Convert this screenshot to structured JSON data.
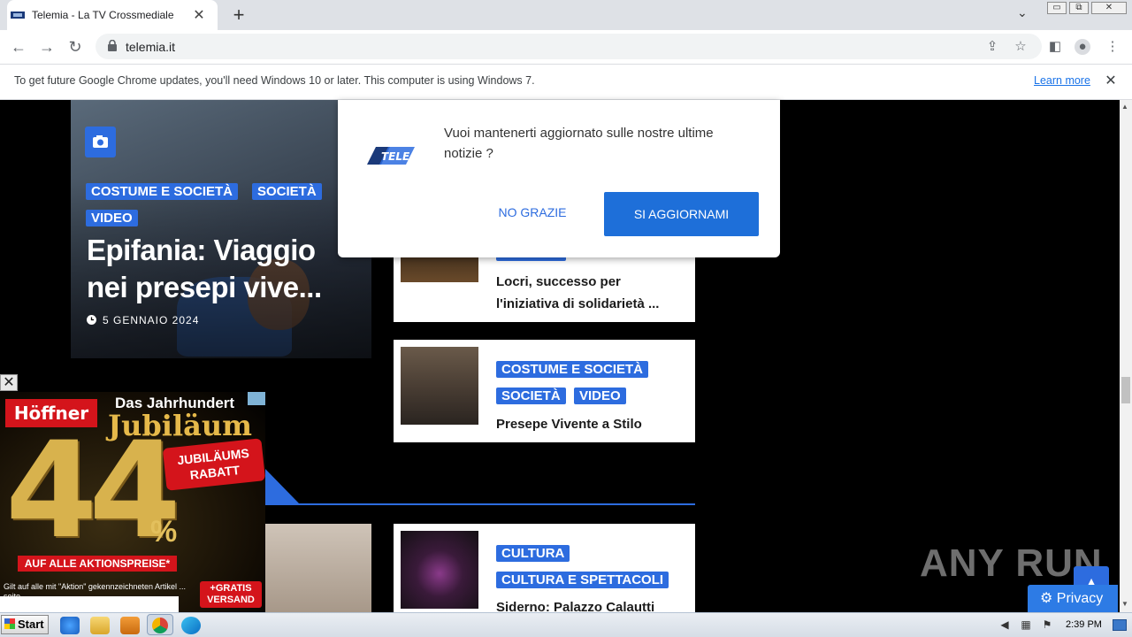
{
  "browser": {
    "tab_title": "Telemia - La TV Crossmediale",
    "tab_close": "✕",
    "new_tab": "+",
    "tab_search": "⌄",
    "window_buttons": [
      "▭",
      "⧉",
      "✕"
    ],
    "url": "telemia.it"
  },
  "infobar": {
    "message": "To get future Google Chrome updates, you'll need Windows 10 or later. This computer is using Windows 7.",
    "link": "Learn more",
    "close": "✕"
  },
  "hero": {
    "tags": [
      "COSTUME E SOCIETÀ",
      "SOCIETÀ",
      "VIDEO"
    ],
    "title": "Epifania: Viaggio nei presepi vive...",
    "date": "5 GENNAIO 2024"
  },
  "cards": [
    {
      "tags": [
        "SOCIETÀ"
      ],
      "title": "Locri, successo per l'iniziativa di solidarietà ..."
    },
    {
      "tags": [
        "COSTUME E SOCIETÀ",
        "SOCIETÀ",
        "VIDEO"
      ],
      "title": "Presepe Vivente a Stilo"
    },
    {
      "tags": [
        "CULTURA",
        "CULTURA E SPETTACOLI"
      ],
      "title": "Siderno: Palazzo Calautti"
    }
  ],
  "notification": {
    "logo_text": "TELE MIA",
    "message": "Vuoi mantenerti aggiornato sulle nostre ultime notizie ?",
    "decline": "NO GRAZIE",
    "accept": "SI AGGIORNAMI"
  },
  "ad": {
    "close": "✕",
    "brand": "Höffner",
    "line1": "Das Jahrhundert",
    "line2": "Jubiläum",
    "big_number": "44",
    "percent": "%",
    "tag": "JUBILÄUMS RABATT",
    "strip": "AUF ALLE AKTIONSPREISE*",
    "footnote": "Gilt auf alle mit \"Aktion\" gekennzeichneten Artikel ... seite",
    "versand": "+GRATIS VERSAND"
  },
  "overlays": {
    "watermark": "ANY RUN",
    "privacy": "Privacy",
    "scroll_top": "▲"
  },
  "taskbar": {
    "start": "Start",
    "clock": "2:39 PM"
  },
  "colors": {
    "accent": "#2d6cdf",
    "notif_button": "#1e6fd9",
    "ad_red": "#d4141b"
  }
}
